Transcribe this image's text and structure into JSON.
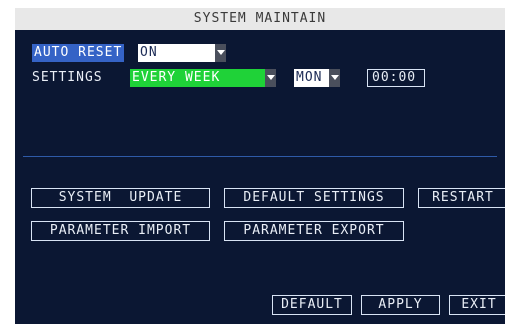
{
  "window": {
    "title": "SYSTEM MAINTAIN"
  },
  "auto_reset": {
    "label": "AUTO RESET",
    "value": "ON"
  },
  "settings": {
    "label": "SETTINGS",
    "frequency": "EVERY WEEK",
    "day": "MON",
    "time": "00:00"
  },
  "actions": {
    "system_update": "SYSTEM  UPDATE",
    "default_settings": "DEFAULT SETTINGS",
    "restart": "RESTART",
    "parameter_import": "PARAMETER IMPORT",
    "parameter_export": "PARAMETER EXPORT"
  },
  "footer": {
    "default": "DEFAULT",
    "apply": "APPLY",
    "exit": "EXIT"
  },
  "colors": {
    "panel_background": "#0b1733",
    "title_background": "#e8e8e8",
    "selected_label": "#3563c6",
    "active_select": "#1fd238"
  },
  "icons": {
    "dropdown": "chevron-down-icon"
  }
}
